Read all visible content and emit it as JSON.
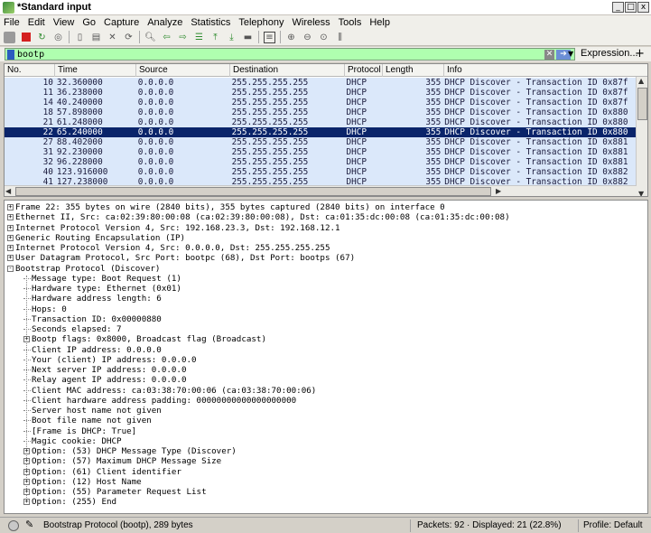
{
  "window": {
    "title": "*Standard input",
    "min": "_",
    "max": "□",
    "close": "x"
  },
  "menu": [
    "File",
    "Edit",
    "View",
    "Go",
    "Capture",
    "Analyze",
    "Statistics",
    "Telephony",
    "Wireless",
    "Tools",
    "Help"
  ],
  "filter": {
    "value": "bootp",
    "expression_label": "Expression...",
    "plus": "+"
  },
  "columns": [
    "No.",
    "Time",
    "Source",
    "Destination",
    "Protocol",
    "Length",
    "Info"
  ],
  "packets": [
    {
      "no": "10",
      "time": "32.360000",
      "src": "0.0.0.0",
      "dst": "255.255.255.255",
      "proto": "DHCP",
      "len": "355",
      "info": "DHCP Discover - Transaction ID 0x87f"
    },
    {
      "no": "11",
      "time": "36.238000",
      "src": "0.0.0.0",
      "dst": "255.255.255.255",
      "proto": "DHCP",
      "len": "355",
      "info": "DHCP Discover - Transaction ID 0x87f"
    },
    {
      "no": "14",
      "time": "40.240000",
      "src": "0.0.0.0",
      "dst": "255.255.255.255",
      "proto": "DHCP",
      "len": "355",
      "info": "DHCP Discover - Transaction ID 0x87f"
    },
    {
      "no": "18",
      "time": "57.898000",
      "src": "0.0.0.0",
      "dst": "255.255.255.255",
      "proto": "DHCP",
      "len": "355",
      "info": "DHCP Discover - Transaction ID 0x880"
    },
    {
      "no": "21",
      "time": "61.248000",
      "src": "0.0.0.0",
      "dst": "255.255.255.255",
      "proto": "DHCP",
      "len": "355",
      "info": "DHCP Discover - Transaction ID 0x880"
    },
    {
      "no": "22",
      "time": "65.240000",
      "src": "0.0.0.0",
      "dst": "255.255.255.255",
      "proto": "DHCP",
      "len": "355",
      "info": "DHCP Discover - Transaction ID 0x880",
      "selected": true
    },
    {
      "no": "27",
      "time": "88.402000",
      "src": "0.0.0.0",
      "dst": "255.255.255.255",
      "proto": "DHCP",
      "len": "355",
      "info": "DHCP Discover - Transaction ID 0x881"
    },
    {
      "no": "31",
      "time": "92.230000",
      "src": "0.0.0.0",
      "dst": "255.255.255.255",
      "proto": "DHCP",
      "len": "355",
      "info": "DHCP Discover - Transaction ID 0x881"
    },
    {
      "no": "32",
      "time": "96.228000",
      "src": "0.0.0.0",
      "dst": "255.255.255.255",
      "proto": "DHCP",
      "len": "355",
      "info": "DHCP Discover - Transaction ID 0x881"
    },
    {
      "no": "40",
      "time": "123.916000",
      "src": "0.0.0.0",
      "dst": "255.255.255.255",
      "proto": "DHCP",
      "len": "355",
      "info": "DHCP Discover - Transaction ID 0x882"
    },
    {
      "no": "41",
      "time": "127.238000",
      "src": "0.0.0.0",
      "dst": "255.255.255.255",
      "proto": "DHCP",
      "len": "355",
      "info": "DHCP Discover - Transaction ID 0x882"
    }
  ],
  "tree": [
    {
      "level": 0,
      "exp": "+",
      "text": "Frame 22: 355 bytes on wire (2840 bits), 355 bytes captured (2840 bits) on interface 0"
    },
    {
      "level": 0,
      "exp": "+",
      "text": "Ethernet II, Src: ca:02:39:80:00:08 (ca:02:39:80:00:08), Dst: ca:01:35:dc:00:08 (ca:01:35:dc:00:08)"
    },
    {
      "level": 0,
      "exp": "+",
      "text": "Internet Protocol Version 4, Src: 192.168.23.3, Dst: 192.168.12.1"
    },
    {
      "level": 0,
      "exp": "+",
      "text": "Generic Routing Encapsulation (IP)"
    },
    {
      "level": 0,
      "exp": "+",
      "text": "Internet Protocol Version 4, Src: 0.0.0.0, Dst: 255.255.255.255"
    },
    {
      "level": 0,
      "exp": "+",
      "text": "User Datagram Protocol, Src Port: bootpc (68), Dst Port: bootps (67)"
    },
    {
      "level": 0,
      "exp": "-",
      "text": "Bootstrap Protocol (Discover)"
    },
    {
      "level": 1,
      "exp": "",
      "text": "Message type: Boot Request (1)"
    },
    {
      "level": 1,
      "exp": "",
      "text": "Hardware type: Ethernet (0x01)"
    },
    {
      "level": 1,
      "exp": "",
      "text": "Hardware address length: 6"
    },
    {
      "level": 1,
      "exp": "",
      "text": "Hops: 0"
    },
    {
      "level": 1,
      "exp": "",
      "text": "Transaction ID: 0x00000880"
    },
    {
      "level": 1,
      "exp": "",
      "text": "Seconds elapsed: 7"
    },
    {
      "level": 1,
      "exp": "+",
      "text": "Bootp flags: 0x8000, Broadcast flag (Broadcast)"
    },
    {
      "level": 1,
      "exp": "",
      "text": "Client IP address: 0.0.0.0"
    },
    {
      "level": 1,
      "exp": "",
      "text": "Your (client) IP address: 0.0.0.0"
    },
    {
      "level": 1,
      "exp": "",
      "text": "Next server IP address: 0.0.0.0"
    },
    {
      "level": 1,
      "exp": "",
      "text": "Relay agent IP address: 0.0.0.0"
    },
    {
      "level": 1,
      "exp": "",
      "text": "Client MAC address: ca:03:38:70:00:06 (ca:03:38:70:00:06)"
    },
    {
      "level": 1,
      "exp": "",
      "text": "Client hardware address padding: 00000000000000000000"
    },
    {
      "level": 1,
      "exp": "",
      "text": "Server host name not given"
    },
    {
      "level": 1,
      "exp": "",
      "text": "Boot file name not given"
    },
    {
      "level": 1,
      "exp": "",
      "text": "[Frame is DHCP: True]"
    },
    {
      "level": 1,
      "exp": "",
      "text": "Magic cookie: DHCP"
    },
    {
      "level": 1,
      "exp": "+",
      "text": "Option: (53) DHCP Message Type (Discover)"
    },
    {
      "level": 1,
      "exp": "+",
      "text": "Option: (57) Maximum DHCP Message Size"
    },
    {
      "level": 1,
      "exp": "+",
      "text": "Option: (61) Client identifier"
    },
    {
      "level": 1,
      "exp": "+",
      "text": "Option: (12) Host Name"
    },
    {
      "level": 1,
      "exp": "+",
      "text": "Option: (55) Parameter Request List"
    },
    {
      "level": 1,
      "exp": "+",
      "text": "Option: (255) End"
    }
  ],
  "status": {
    "field": "Bootstrap Protocol (bootp), 289 bytes",
    "packets": "Packets: 92 · Displayed: 21 (22.8%)",
    "profile": "Profile: Default"
  },
  "colors": {
    "row_bg": "#dbe8fa",
    "row_selected": "#0a246a",
    "filter_valid": "#afffaf"
  }
}
